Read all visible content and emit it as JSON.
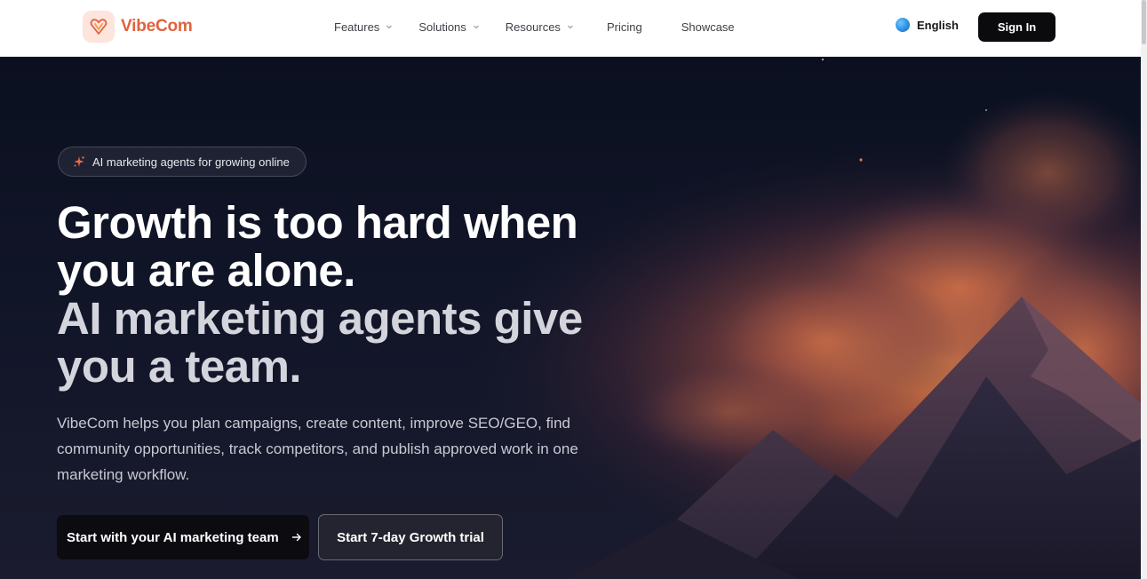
{
  "brand": {
    "name": "VibeCom",
    "accent": "#e0623f"
  },
  "nav": {
    "items": [
      {
        "label": "Features",
        "has_dropdown": true
      },
      {
        "label": "Solutions",
        "has_dropdown": true
      },
      {
        "label": "Resources",
        "has_dropdown": true
      },
      {
        "label": "Pricing",
        "has_dropdown": false
      },
      {
        "label": "Showcase",
        "has_dropdown": false
      }
    ],
    "language": "English",
    "sign_in": "Sign In"
  },
  "hero": {
    "badge": "AI marketing agents for growing online",
    "headline_primary": "Growth is too hard when you are alone.",
    "headline_secondary": "AI marketing agents give you a team.",
    "description": "VibeCom helps you plan campaigns, create content, improve SEO/GEO, find community opportunities, track competitors, and publish approved work in one marketing workflow.",
    "cta_primary": "Start with your AI marketing team",
    "cta_secondary": "Start 7-day Growth trial"
  },
  "icons": {
    "logo": "heart-v-logo-icon",
    "language": "globe-icon",
    "badge": "sparkle-icon",
    "cta": "arrow-right-icon",
    "dropdown": "chevron-down-icon"
  }
}
